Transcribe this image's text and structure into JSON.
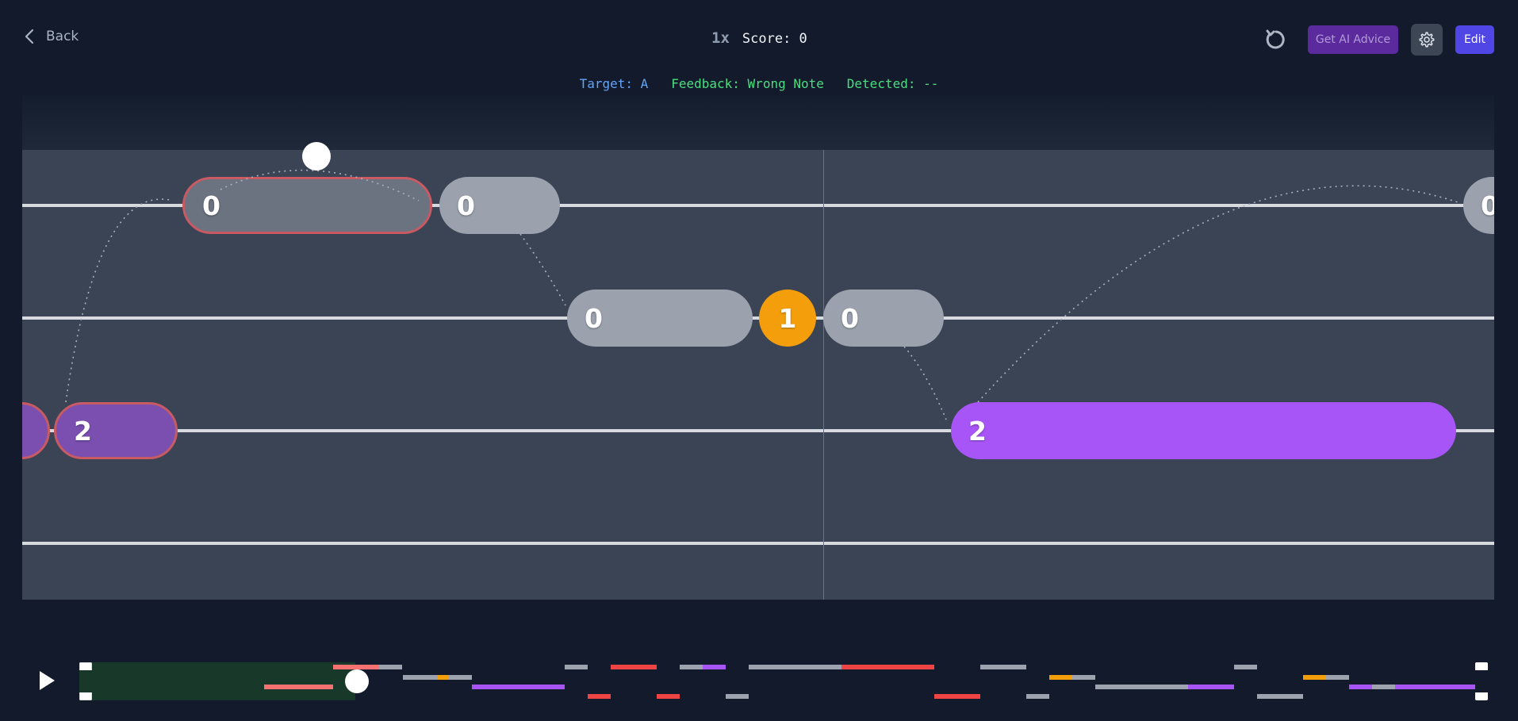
{
  "header": {
    "back_label": "Back",
    "speed": "1x",
    "score_text": "Score: 0",
    "ai_button_label": "Get AI Advice",
    "edit_button_label": "Edit"
  },
  "status": {
    "target_label": "Target: ",
    "target_value": "A",
    "feedback_label": "Feedback: ",
    "feedback_value": "Wrong Note",
    "detected_label": "Detected: ",
    "detected_value": "--"
  },
  "notes": {
    "string1": [
      "0",
      "0",
      "0"
    ],
    "string2": [
      "0",
      "1",
      "0"
    ],
    "string3": [
      "2",
      "2"
    ]
  },
  "colors": {
    "accent": "#4f46e5",
    "ai": "#5b2a9c",
    "note_gray": "#9ba1ad",
    "note_purple": "#a855f7",
    "note_orange": "#f59e0b",
    "missed_border": "#c75a62",
    "progress": "#18382a"
  }
}
